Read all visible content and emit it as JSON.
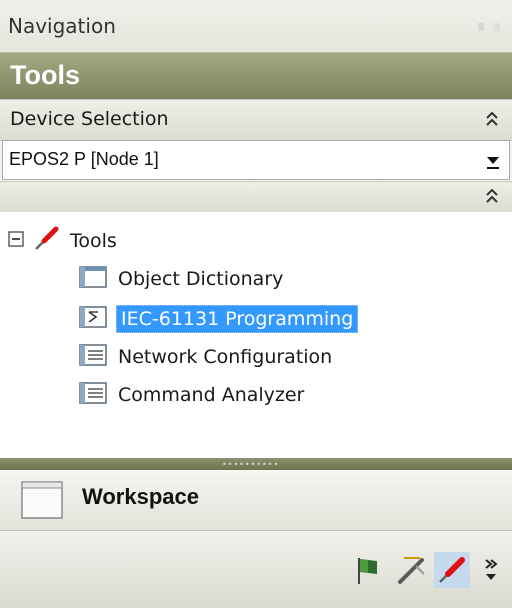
{
  "window": {
    "title": "Navigation"
  },
  "tools_header": {
    "label": "Tools"
  },
  "device_selection": {
    "label": "Device Selection",
    "selected_value": "EPOS2 P [Node 1]"
  },
  "tree": {
    "root_label": "Tools",
    "items": [
      {
        "label": "Object Dictionary",
        "icon": "object-dictionary-icon",
        "selected": false
      },
      {
        "label": "IEC-61131 Programming",
        "icon": "programming-icon",
        "selected": true
      },
      {
        "label": "Network Configuration",
        "icon": "network-configuration-icon",
        "selected": false
      },
      {
        "label": "Command Analyzer",
        "icon": "command-analyzer-icon",
        "selected": false
      }
    ]
  },
  "workspace": {
    "label": "Workspace"
  },
  "toolbar": {
    "buttons": [
      "flag-icon",
      "wizard-icon",
      "tools-icon",
      "overflow-chevron-icon"
    ],
    "active": "tools-icon"
  },
  "colors": {
    "header_green": "#7a835d",
    "selection_blue": "#3399ff"
  }
}
